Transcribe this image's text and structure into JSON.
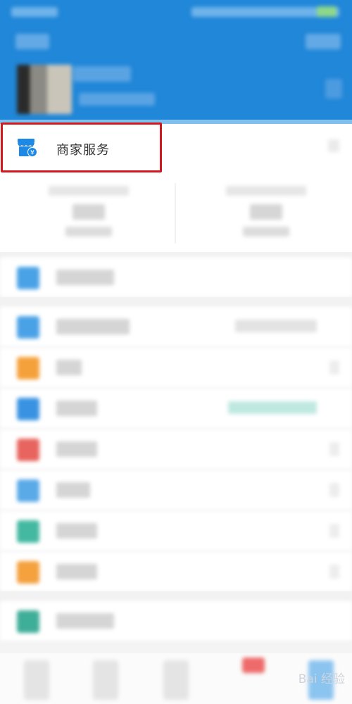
{
  "merchant_service": {
    "label": "商家服务",
    "icon": "store-icon"
  },
  "menu_items": [
    {
      "icon": "menu-icon-1",
      "color": "#4aa2e6"
    },
    {
      "icon": "menu-icon-2",
      "color": "#4aa2e6"
    },
    {
      "icon": "menu-icon-3",
      "color": "#f5a13b"
    },
    {
      "icon": "menu-icon-4",
      "color": "#3a93e2"
    },
    {
      "icon": "menu-icon-5",
      "color": "#e8645e"
    },
    {
      "icon": "menu-icon-6",
      "color": "#5aaae8"
    },
    {
      "icon": "menu-icon-7",
      "color": "#44b8a1"
    },
    {
      "icon": "menu-icon-8",
      "color": "#f4a13e"
    },
    {
      "icon": "menu-icon-9",
      "color": "#3fae98"
    }
  ],
  "colors": {
    "header": "#2187d8",
    "highlight": "#d0191f"
  },
  "watermark": "Bai 经验"
}
